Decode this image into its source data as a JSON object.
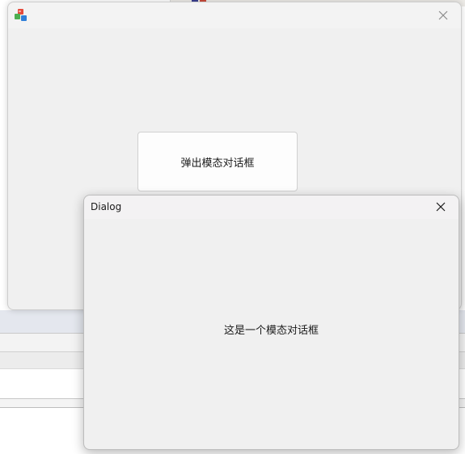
{
  "main_window": {
    "title": "",
    "icon": "app-cubes-icon",
    "close_icon": "close-icon",
    "popup_button_label": "弹出模态对话框"
  },
  "dialog": {
    "title": "Dialog",
    "close_icon": "close-icon",
    "message": "这是一个模态对话框"
  },
  "colors": {
    "window_bg": "#f0f0f0",
    "titlebar_bg": "#f3f3f3",
    "button_bg": "#fdfdfd",
    "border": "#cdcdcd"
  }
}
